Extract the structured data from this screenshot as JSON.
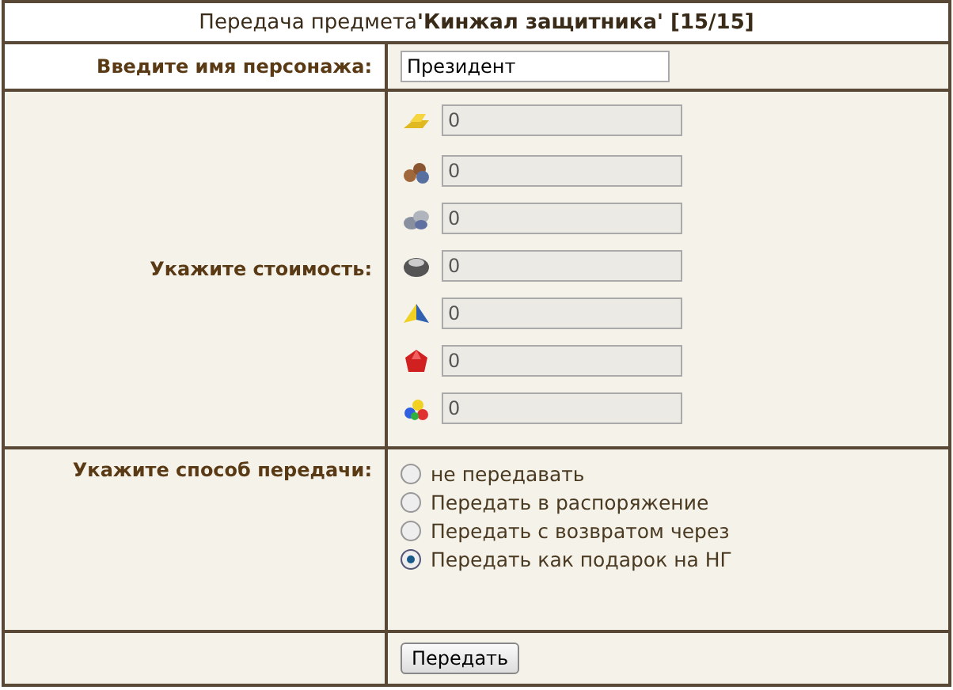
{
  "title": "Передача предмета**'Кинжал защитника' [15/15]**",
  "name_row": {
    "label": "Введите имя персонажа:",
    "value": "Президент"
  },
  "cost_row": {
    "label": "Укажите стоимость:",
    "resources": [
      {
        "kind": "gold",
        "value": "0",
        "disabled": true
      },
      {
        "kind": "wood",
        "value": "0",
        "disabled": true
      },
      {
        "kind": "ore",
        "value": "0",
        "disabled": true
      },
      {
        "kind": "mercury",
        "value": "0",
        "disabled": true
      },
      {
        "kind": "sulfur",
        "value": "0",
        "disabled": true
      },
      {
        "kind": "crystal",
        "value": "0",
        "disabled": true
      },
      {
        "kind": "gems",
        "value": "0",
        "disabled": true
      }
    ]
  },
  "method_row": {
    "label": "Укажите способ передачи:",
    "options": [
      {
        "label": "не передавать",
        "selected": false
      },
      {
        "label": "Передать в распоряжение",
        "selected": false
      },
      {
        "label": "Передать с возвратом через",
        "selected": false
      },
      {
        "label": "Передать как подарок на НГ",
        "selected": true
      }
    ]
  },
  "submit_button": "Передать"
}
